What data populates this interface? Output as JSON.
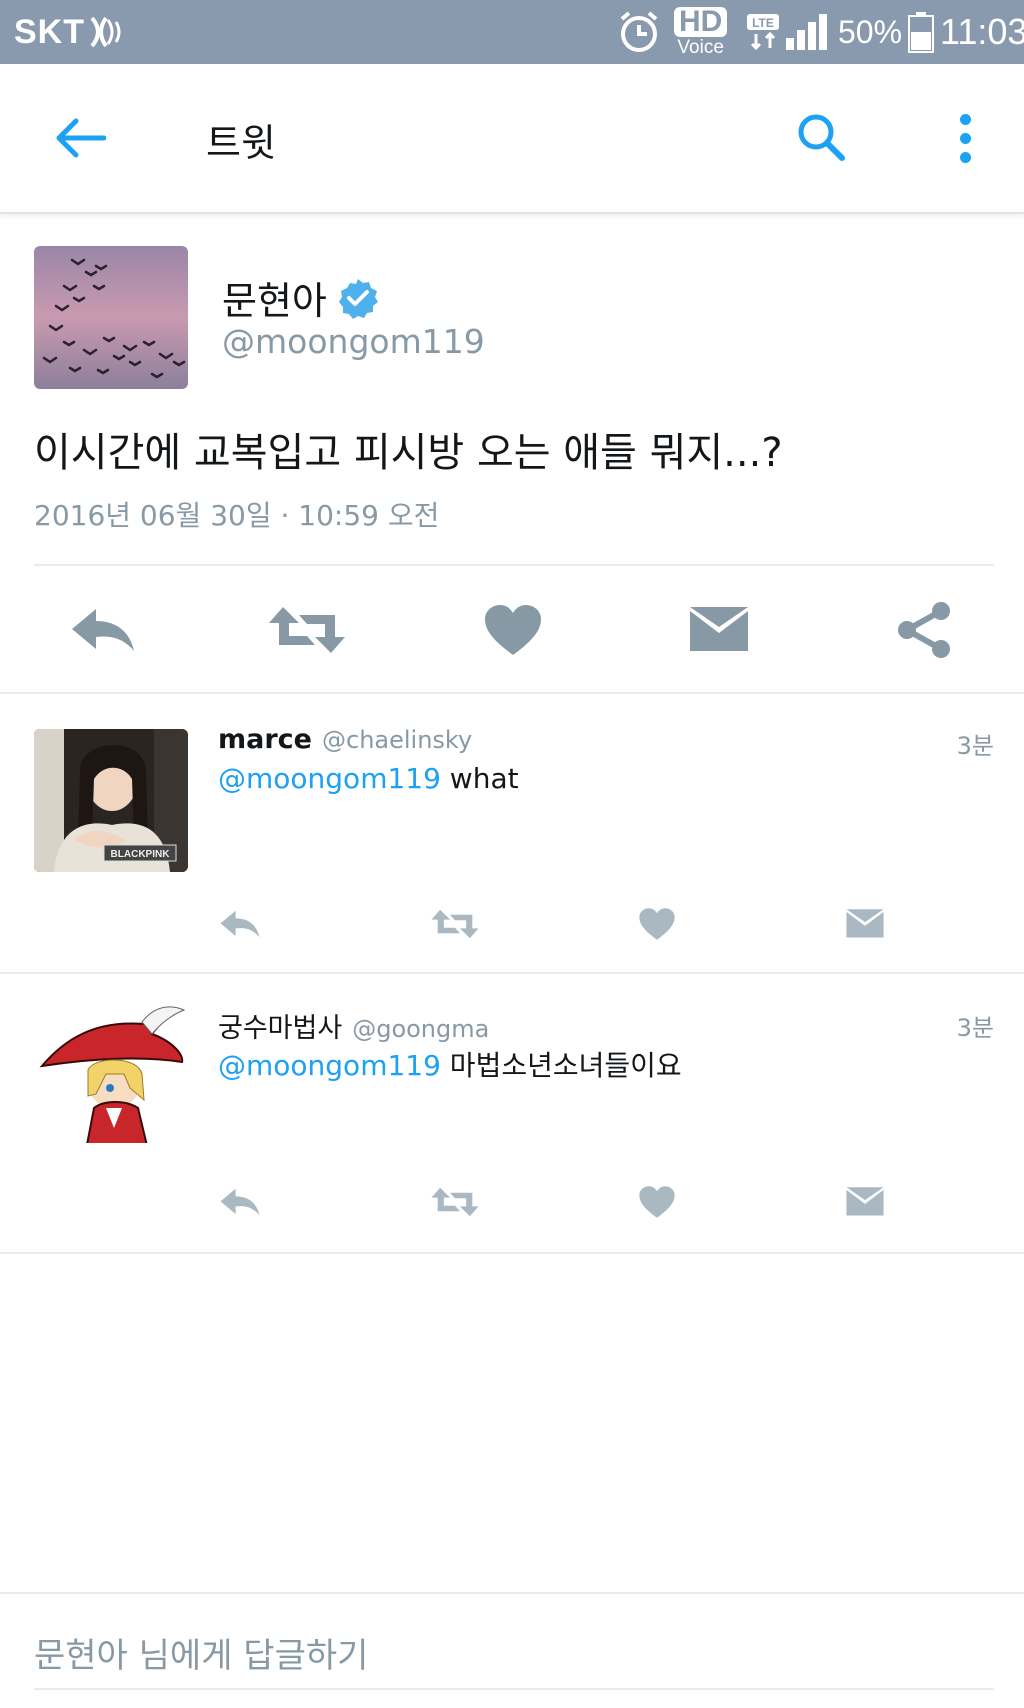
{
  "status_bar": {
    "carrier": "SKT",
    "hd": "HD",
    "voice": "Voice",
    "network": "LTE",
    "battery_percent": "50%",
    "time": "11:03"
  },
  "app_bar": {
    "title": "트윗",
    "accent_color": "#1da1f2"
  },
  "main_tweet": {
    "name": "문현아",
    "handle": "@moongom119",
    "verified": true,
    "text": "이시간에 교복입고 피시방 오는 애들 뭐지...?",
    "timestamp": "2016년 06월 30일 · 10:59 오전",
    "actions": [
      "reply-icon",
      "retweet-icon",
      "like-icon",
      "message-icon",
      "share-icon"
    ]
  },
  "replies": [
    {
      "name": "marce",
      "handle": "@chaelinsky",
      "time": "3분",
      "mention": "@moongom119",
      "text": " what",
      "avatar_badge": "BLACKPINK"
    },
    {
      "name": "궁수마법사",
      "handle": "@goongma",
      "time": "3분",
      "mention": "@moongom119",
      "text": " 마법소년소녀들이요"
    }
  ],
  "reply_bar": {
    "placeholder": "문현아 님에게 답글하기"
  }
}
